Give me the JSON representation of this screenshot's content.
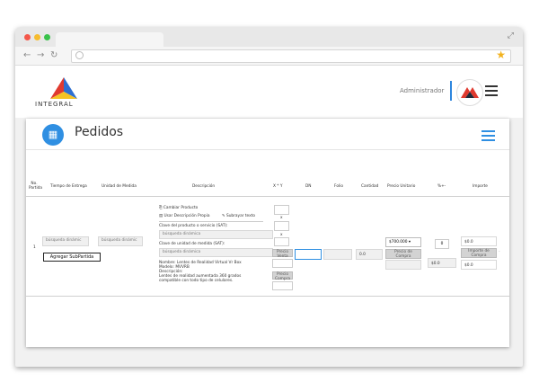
{
  "header": {
    "logo_text": "INTEGRAL",
    "admin_label": "Administrador"
  },
  "panel": {
    "title": "Pedidos"
  },
  "table": {
    "headers": {
      "no_partida": "No. Partida",
      "tiempo_entrega": "Tiempo de Entrega",
      "unidad_medida": "Unidad de Medida",
      "descripcion": "Descripción",
      "xyy": "X * Y",
      "dn": "DN",
      "folio": "Folio",
      "cantidad": "Cantidad",
      "precio_unitario": "Precio Unitario",
      "pct": "%+-",
      "importe": "Importe"
    },
    "row": {
      "no": "1",
      "tiempo_placeholder": "búsqueda dinámic",
      "agregar_subpartida": "Agregar SubPartida",
      "unidad_placeholder": "búsqueda dinámic",
      "cambiar_producto": "Cambiar Producto",
      "usar_desc_propia": "Usar Descripción Propia",
      "subrayar_texto": "Subrayar texto",
      "clave_producto_label": "Clave del producto o servicio (SAT):",
      "clave_producto_placeholder": "búsqueda dinámica",
      "clave_unidad_label": "Clave de unidad de medida (SAT):",
      "clave_unidad_placeholder": "búsqueda dinámica",
      "nombre": "Nombre: Lentes de Realidad Virtual Vr Box",
      "modelo": "Modelo: MVVRB",
      "descripcion_label": "Descripción:",
      "descripcion_1": "Lentes de realidad aumentada 360 grados",
      "descripcion_2": "compatible con todo tipo de celulares.",
      "x_label": "x",
      "precio_venta": "Precio Venta",
      "precio_compra": "Precio Compra",
      "cantidad": "0.0",
      "precio_select": "$700.000",
      "precio_compra_btn": "Precio de Compra",
      "pct_value": "0",
      "pct_total": "$0.0",
      "importe_1": "$0.0",
      "importe_compra_btn": "Importe de Compra",
      "importe_2": "$0.0"
    }
  },
  "colors": {
    "accent": "#2f8fe2",
    "logo_red": "#e03a2f",
    "logo_blue": "#2d6fd1",
    "logo_yellow": "#f5c324"
  },
  "icons": [
    "expand-icon",
    "back-arrow-icon",
    "forward-arrow-icon",
    "reload-icon",
    "globe-icon",
    "bookmark-star-icon",
    "user-logo-icon",
    "menu-icon",
    "calculator-icon",
    "hamburger-icon"
  ]
}
